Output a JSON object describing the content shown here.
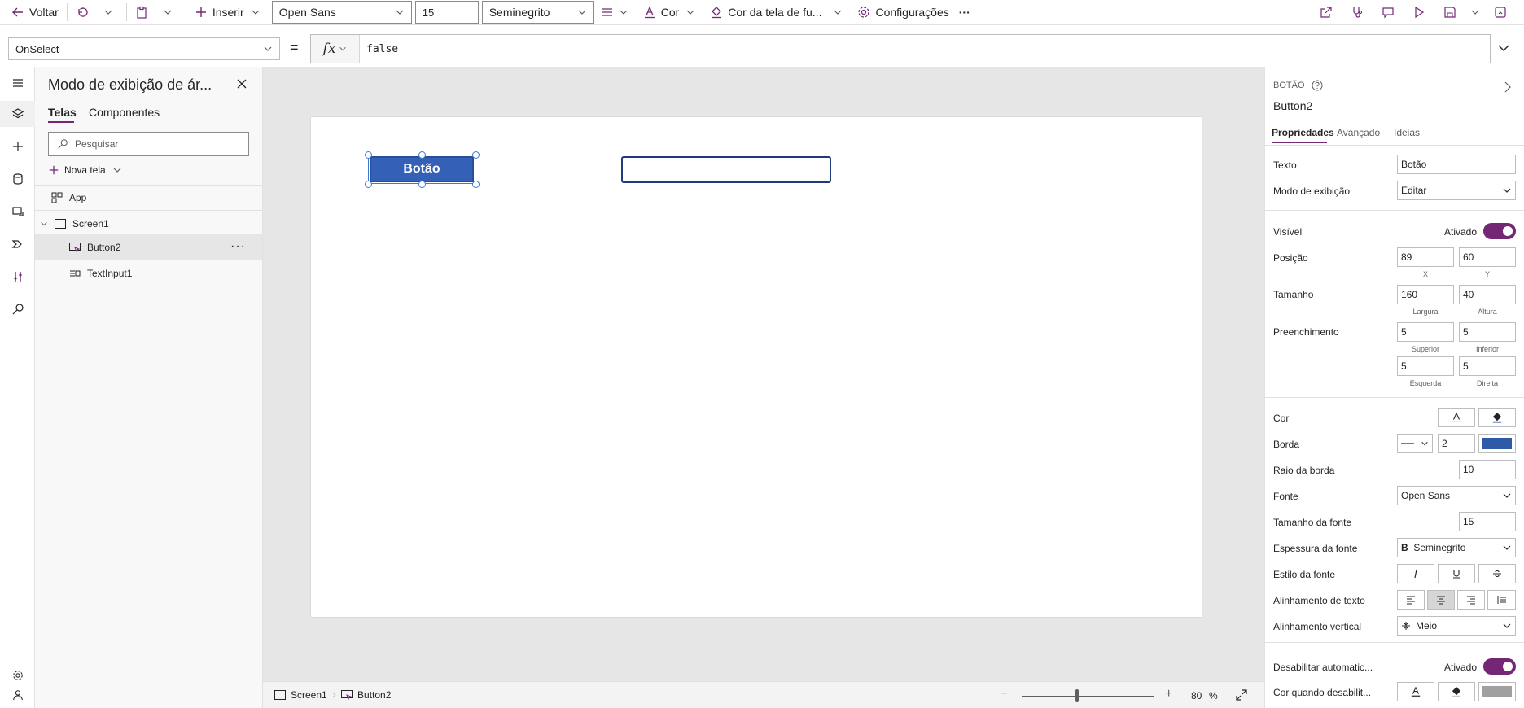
{
  "toolbar": {
    "back": "Voltar",
    "insert": "Inserir",
    "font": "Open Sans",
    "font_size": "15",
    "font_weight": "Seminegrito",
    "color": "Cor",
    "screen_color": "Cor da tela de fu...",
    "settings": "Configurações",
    "more": "···"
  },
  "formula": {
    "property": "OnSelect",
    "equals": "=",
    "fx": "fx",
    "value": "false"
  },
  "tree": {
    "title": "Modo de exibição de ár...",
    "tabs": [
      "Telas",
      "Componentes"
    ],
    "search_placeholder": "Pesquisar",
    "new_screen": "Nova tela",
    "items": {
      "app": "App",
      "screen": "Screen1",
      "button": "Button2",
      "textinput": "TextInput1"
    },
    "more": "···"
  },
  "canvas": {
    "button_label": "Botão"
  },
  "statusbar": {
    "crumb_screen": "Screen1",
    "crumb_button": "Button2",
    "zoom_minus": "−",
    "zoom_plus": "+",
    "zoom": "80",
    "zoom_unit": "%",
    "zoom_level": 0.42
  },
  "props": {
    "type": "BOTÃO",
    "name": "Button2",
    "tabs": [
      "Propriedades",
      "Avançado",
      "Ideias"
    ],
    "text_label": "Texto",
    "text_value": "Botão",
    "display_mode_label": "Modo de exibição",
    "display_mode_value": "Editar",
    "visible_label": "Visível",
    "visible_state": "Ativado",
    "position_label": "Posição",
    "pos_x": "89",
    "pos_y": "60",
    "pos_x_sub": "X",
    "pos_y_sub": "Y",
    "size_label": "Tamanho",
    "width": "160",
    "height": "40",
    "width_sub": "Largura",
    "height_sub": "Altura",
    "padding_label": "Preenchimento",
    "pad_top": "5",
    "pad_bottom": "5",
    "pad_top_sub": "Superior",
    "pad_bottom_sub": "Inferior",
    "pad_left": "5",
    "pad_right": "5",
    "pad_left_sub": "Esquerda",
    "pad_right_sub": "Direita",
    "color_label": "Cor",
    "border_label": "Borda",
    "border_width": "2",
    "border_color": "#2f5aa8",
    "radius_label": "Raio da borda",
    "radius_value": "10",
    "font_label": "Fonte",
    "font_value": "Open Sans",
    "font_size_label": "Tamanho da fonte",
    "font_size_value": "15",
    "font_weight_label": "Espessura da fonte",
    "font_weight_value": "Seminegrito",
    "font_weight_prefix": "B",
    "font_style_label": "Estilo da fonte",
    "text_align_label": "Alinhamento de texto",
    "vertical_align_label": "Alinhamento vertical",
    "vertical_align_value": "Meio",
    "auto_disable_label": "Desabilitar automatic...",
    "auto_disable_state": "Ativado",
    "disabled_color_label": "Cor quando desabilit..."
  },
  "colors": {
    "accent": "#742774",
    "button_fill": "#3460b8",
    "input_border": "#1f3b7a"
  }
}
